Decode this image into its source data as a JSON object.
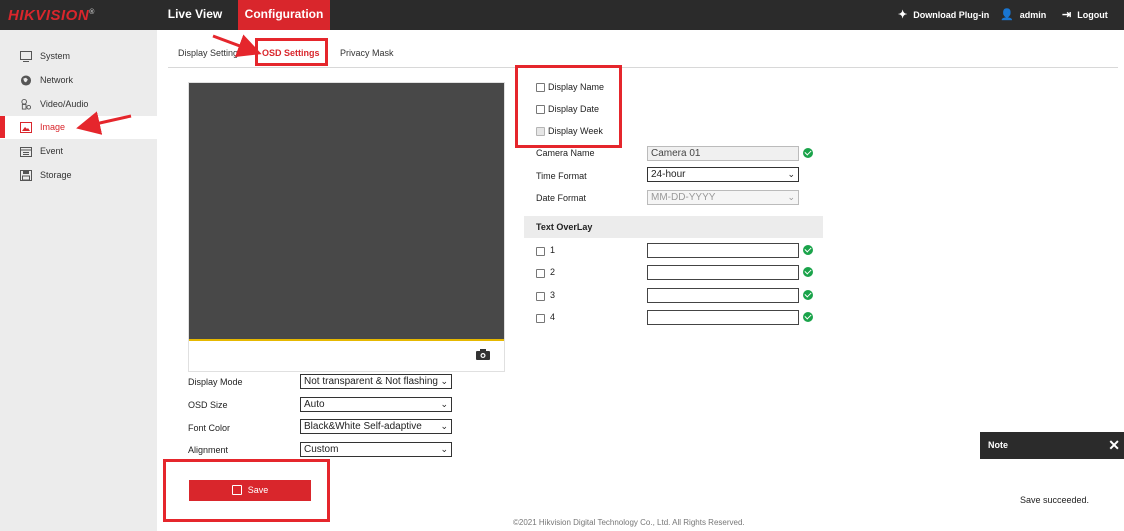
{
  "brand": {
    "logo": "HIKVISION",
    "logo_mark": "®"
  },
  "topnav": {
    "live_view": "Live View",
    "configuration": "Configuration"
  },
  "topright": {
    "download": "Download Plug-in",
    "user": "admin",
    "logout": "Logout"
  },
  "sidebar": {
    "items": [
      {
        "label": "System",
        "icon": "monitor-icon"
      },
      {
        "label": "Network",
        "icon": "globe-icon"
      },
      {
        "label": "Video/Audio",
        "icon": "video-audio-icon"
      },
      {
        "label": "Image",
        "icon": "image-icon",
        "active": true
      },
      {
        "label": "Event",
        "icon": "calendar-icon"
      },
      {
        "label": "Storage",
        "icon": "floppy-icon"
      }
    ]
  },
  "tabs": [
    {
      "label": "Display Settings"
    },
    {
      "label": "OSD Settings",
      "active": true
    },
    {
      "label": "Privacy Mask"
    }
  ],
  "osd": {
    "display_name": {
      "label": "Display Name",
      "checked": false
    },
    "display_date": {
      "label": "Display Date",
      "checked": false
    },
    "display_week": {
      "label": "Display Week",
      "checked": false,
      "disabled": true
    },
    "camera_name": {
      "label": "Camera Name",
      "value": "Camera 01"
    },
    "time_format": {
      "label": "Time Format",
      "value": "24-hour"
    },
    "date_format": {
      "label": "Date Format",
      "value": "MM-DD-YYYY"
    },
    "text_overlay": {
      "title": "Text OverLay",
      "items": [
        {
          "label": "1",
          "value": ""
        },
        {
          "label": "2",
          "value": ""
        },
        {
          "label": "3",
          "value": ""
        },
        {
          "label": "4",
          "value": ""
        }
      ]
    },
    "display_mode": {
      "label": "Display Mode",
      "value": "Not transparent & Not flashing"
    },
    "osd_size": {
      "label": "OSD Size",
      "value": "Auto"
    },
    "font_color": {
      "label": "Font Color",
      "value": "Black&White Self-adaptive"
    },
    "alignment": {
      "label": "Alignment",
      "value": "Custom"
    }
  },
  "save": {
    "label": "Save"
  },
  "footer": "©2021 Hikvision Digital Technology Co., Ltd. All Rights Reserved.",
  "note": {
    "title": "Note",
    "message": "Save succeeded."
  },
  "colors": {
    "accent": "#d9262c",
    "topbar": "#2b2b2b",
    "sidebar": "#ececec",
    "success": "#1aa34a",
    "annotation": "#e5262c"
  }
}
